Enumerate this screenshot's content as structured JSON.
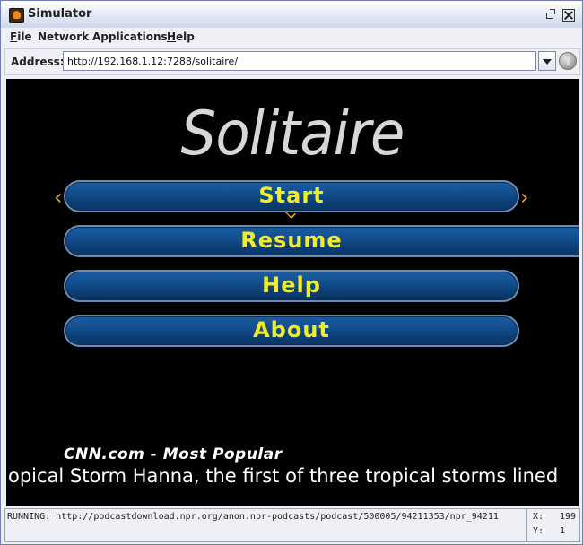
{
  "window": {
    "title": "Simulator"
  },
  "menubar": {
    "items": [
      {
        "label_first": "F",
        "label_rest": "ile"
      },
      {
        "label_first": "",
        "label_rest": "Network"
      },
      {
        "label_first": "",
        "label_rest": "Applications"
      },
      {
        "label_first": "H",
        "label_rest": "elp"
      }
    ]
  },
  "address": {
    "label": "Address:",
    "value": "http://192.168.1.12:7288/solitaire/"
  },
  "screen": {
    "logo": "Solitaire",
    "buttons": {
      "start": "Start",
      "resume": "Resume",
      "help": "Help",
      "about": "About"
    },
    "chevrons": {
      "left": "‹",
      "right": "›"
    },
    "news_title": "CNN.com - Most Popular",
    "news_ticker": "opical Storm Hanna, the first of three tropical storms lined"
  },
  "status": {
    "text": "RUNNING: http://podcastdownload.npr.org/anon.npr-podcasts/podcast/500005/94211353/npr_94211",
    "x_label": "X:",
    "x_value": "199",
    "y_label": "Y:",
    "y_value": "1"
  },
  "colors": {
    "accent_text": "#f2ec23",
    "button_fill": "#124f8f",
    "chevron": "#e9a827",
    "screen_bg": "#000000"
  }
}
